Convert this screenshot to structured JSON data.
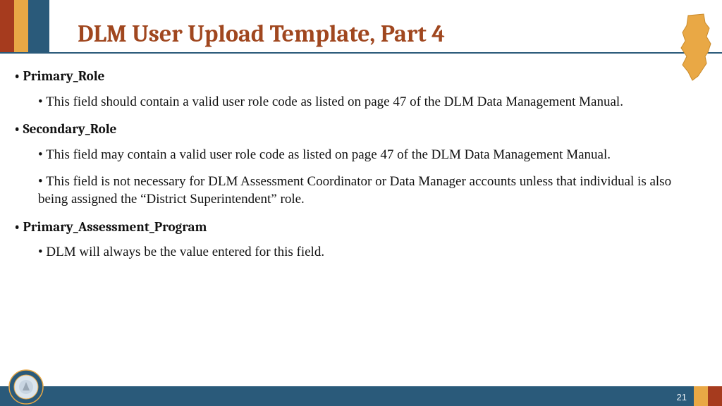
{
  "title": "DLM User Upload Template, Part 4",
  "page_number": "21",
  "bullets": [
    {
      "heading": "Primary_Role",
      "subs": [
        "This field should contain a valid user role code as listed on page 47 of the DLM Data Management Manual."
      ]
    },
    {
      "heading": "Secondary_Role",
      "subs": [
        "This field may contain a valid user role code as listed on page 47 of the DLM Data Management Manual.",
        "This field is not necessary for DLM Assessment Coordinator or Data Manager accounts unless that individual is also being assigned the “District Superintendent” role."
      ]
    },
    {
      "heading": "Primary_Assessment_Program",
      "subs": [
        "DLM will always be the value entered for this field."
      ]
    }
  ]
}
